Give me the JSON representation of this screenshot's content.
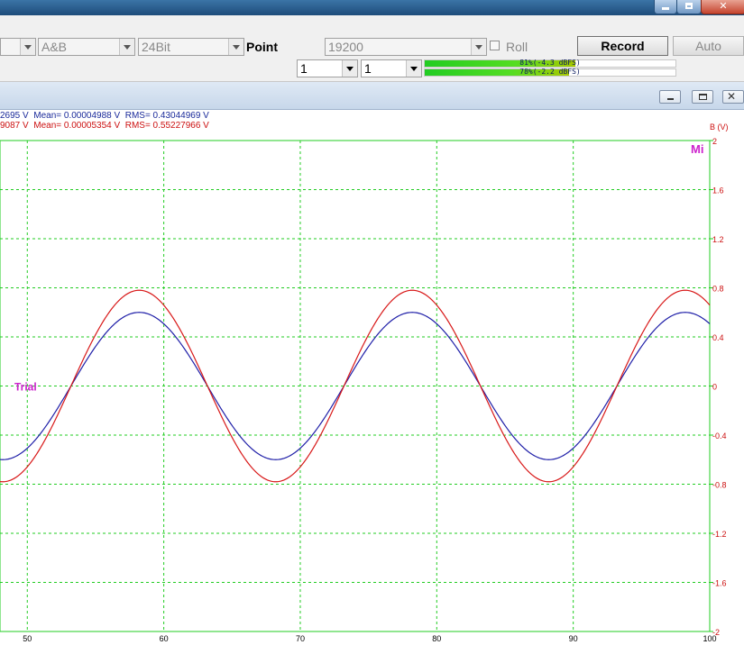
{
  "toolbar": {
    "channel_select": "A&B",
    "bitdepth_select": "24Bit",
    "point_label": "Point",
    "rate_select": "19200",
    "roll_label": "Roll",
    "record_label": "Record",
    "auto_label": "Auto",
    "select_1": "1",
    "select_2": "1"
  },
  "meters": [
    {
      "label": "81%(-4.3 dBFS)",
      "level": 0.81
    },
    {
      "label": "78%(-2.2 dBFS)",
      "level": 0.78
    }
  ],
  "stats": {
    "a": "2695 V  Mean= 0.00004988 V  RMS= 0.43044969 V",
    "b": "9087 V  Mean= 0.00005354 V  RMS= 0.55227966 V"
  },
  "plot": {
    "trial_label": "Trial",
    "corner_label": "Mi"
  },
  "colors": {
    "grid": "#22cc22",
    "series_a": "#1f1fa8",
    "series_b": "#d81818",
    "accent_label": "#cc22cc"
  },
  "chart_data": {
    "type": "line",
    "x_ticks": [
      50,
      60,
      70,
      80,
      90,
      100
    ],
    "xlim": [
      48,
      100
    ],
    "ylabel": "B (V)",
    "y_ticks": [
      2,
      1.6,
      1.2,
      0.8,
      0.4,
      0,
      -0.4,
      -0.8,
      -1.2,
      -1.6,
      -2
    ],
    "ylim": [
      -2,
      2
    ],
    "grid": true,
    "series": [
      {
        "color": "#1f1fa8",
        "amplitude": 0.6,
        "period": 20,
        "zero_cross_x": 53.2,
        "x": [
          48,
          53.2,
          58.2,
          63.2,
          68.2,
          73.2,
          78.2,
          83.2,
          88.2,
          93.2,
          98.2,
          100
        ],
        "y": [
          -0.58,
          0,
          0.6,
          0,
          -0.6,
          0,
          0.6,
          0,
          -0.6,
          0,
          0.6,
          0.5
        ]
      },
      {
        "color": "#d81818",
        "amplitude": 0.78,
        "period": 20,
        "zero_cross_x": 53.2,
        "x": [
          48,
          53.2,
          58.2,
          63.2,
          68.2,
          73.2,
          78.2,
          83.2,
          88.2,
          93.2,
          98.2,
          100
        ],
        "y": [
          -0.76,
          0,
          0.78,
          0,
          -0.78,
          0,
          0.78,
          0,
          -0.78,
          0,
          0.78,
          0.66
        ]
      }
    ]
  }
}
